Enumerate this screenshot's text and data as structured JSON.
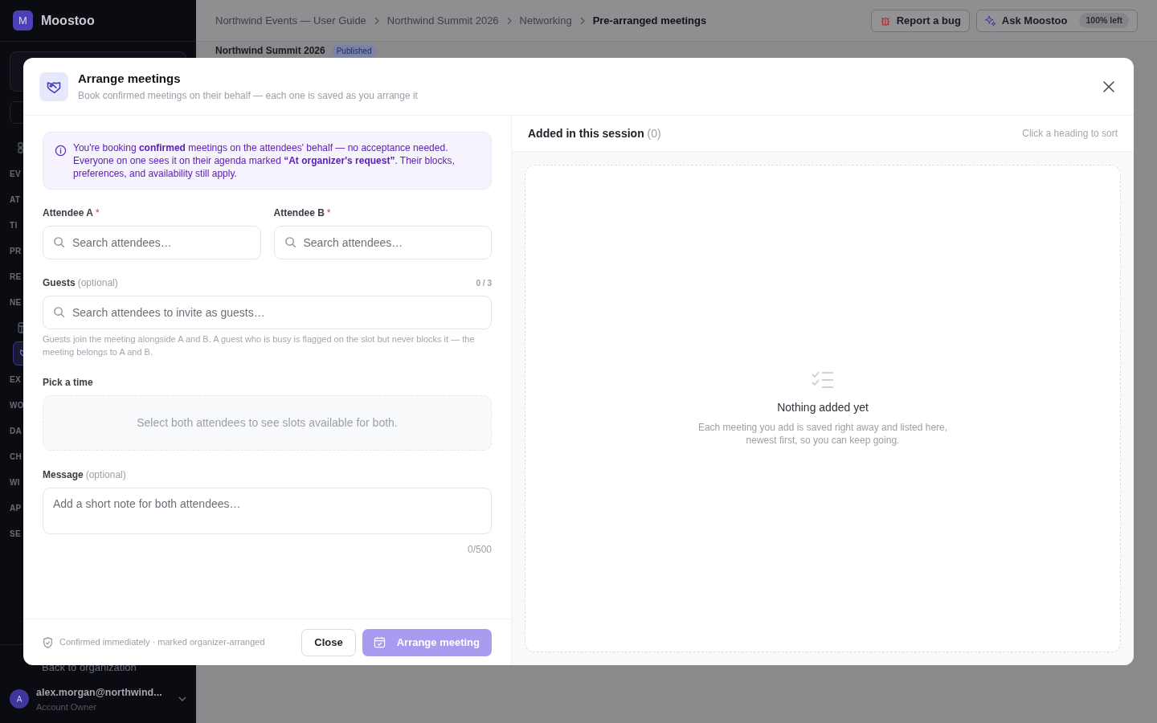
{
  "app": {
    "logo_letter": "M",
    "name": "Moostoo"
  },
  "sidebar": {
    "nav": [
      {
        "kind": "grid",
        "selected": false
      },
      {
        "kind": "heading",
        "label": "EV"
      },
      {
        "kind": "heading",
        "label": "AT"
      },
      {
        "kind": "heading",
        "label": "TI"
      },
      {
        "kind": "heading",
        "label": "PR"
      },
      {
        "kind": "heading",
        "label": "RE"
      },
      {
        "kind": "heading",
        "label": "NE"
      },
      {
        "kind": "table",
        "selected": false
      },
      {
        "kind": "handshake",
        "selected": true
      },
      {
        "kind": "heading",
        "label": "EX"
      },
      {
        "kind": "heading",
        "label": "WO"
      },
      {
        "kind": "heading",
        "label": "DA"
      },
      {
        "kind": "heading",
        "label": "CH"
      },
      {
        "kind": "heading",
        "label": "WI"
      },
      {
        "kind": "heading",
        "label": "AP"
      },
      {
        "kind": "heading",
        "label": "SE"
      }
    ],
    "back_link": "Back to organization",
    "user": {
      "initial": "A",
      "email": "alex.morgan@northwind...",
      "role": "Account Owner"
    }
  },
  "breadcrumbs": [
    {
      "label": "Northwind Events — User Guide",
      "current": false
    },
    {
      "label": "Northwind Summit 2026",
      "current": false
    },
    {
      "label": "Networking",
      "current": false
    },
    {
      "label": "Pre-arranged meetings",
      "current": true
    }
  ],
  "top_actions": {
    "report": "Report a bug",
    "ask": "Ask Moostoo",
    "ask_badge": "100% left"
  },
  "page_header": {
    "title": "Northwind Summit 2026",
    "status": "Published"
  },
  "modal": {
    "title": "Arrange meetings",
    "subtitle": "Book confirmed meetings on their behalf — each one is saved as you arrange it",
    "notice": "You're booking **confirmed** meetings on the attendees' behalf — no acceptance needed. Everyone on one sees it on their agenda marked **“At organizer's request”**. Their blocks, preferences, and availability still apply.",
    "attendee_fields": [
      {
        "label": "Attendee A",
        "required_mark": "*",
        "placeholder": "Search attendees…"
      },
      {
        "label": "Attendee B",
        "required_mark": "*",
        "placeholder": "Search attendees…"
      }
    ],
    "guests": {
      "label": "Guests",
      "hint": "(optional)",
      "count": "0 / 3",
      "placeholder": "Search attendees to invite as guests…",
      "help": "Guests join the meeting alongside A and B. A guest who is busy is flagged on the slot but never blocks it — the meeting belongs to A and B."
    },
    "time": {
      "label": "Pick a time",
      "empty_text": "Select both attendees to see slots available for both."
    },
    "message": {
      "label": "Message",
      "hint": "(optional)",
      "placeholder": "Add a short note for both attendees…",
      "count": "0/500"
    },
    "footer": {
      "note": "Confirmed immediately · marked organizer-arranged",
      "close": "Close",
      "submit": "Arrange meeting",
      "submit_disabled": true
    },
    "session": {
      "title": "Added in this session",
      "count": "(0)",
      "sort_hint": "Click a heading to sort",
      "empty_title": "Nothing added yet",
      "empty_text": "Each meeting you add is saved right away and listed here, newest first, so you can keep going."
    }
  }
}
